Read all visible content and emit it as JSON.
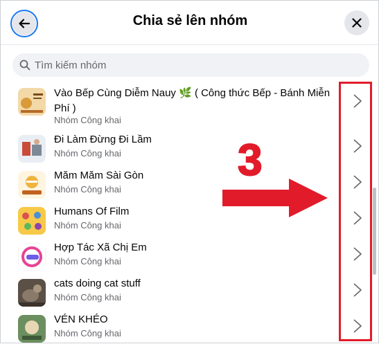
{
  "header": {
    "title": "Chia sẻ lên nhóm",
    "back_icon": "arrow-left-icon",
    "close_icon": "close-icon"
  },
  "search": {
    "placeholder": "Tìm kiếm nhóm",
    "value": ""
  },
  "groups": [
    {
      "name": "Vào Bếp Cùng Diễm Nauy 🌿 ( Công thức Bếp - Bánh Miễn Phí )",
      "privacy": "Nhóm Công khai"
    },
    {
      "name": "Đi Làm Đừng Đi Lầm",
      "privacy": "Nhóm Công khai"
    },
    {
      "name": "Măm Măm Sài Gòn",
      "privacy": "Nhóm Công khai"
    },
    {
      "name": "Humans Of Film",
      "privacy": "Nhóm Công khai"
    },
    {
      "name": "Hợp Tác Xã Chị Em",
      "privacy": "Nhóm Công khai"
    },
    {
      "name": "cats doing cat stuff",
      "privacy": "Nhóm Công khai"
    },
    {
      "name": "VÉN KHÉO",
      "privacy": "Nhóm Công khai"
    }
  ],
  "annotation": {
    "step_number": "3",
    "color": "#e21b2a"
  },
  "colors": {
    "accent": "#1877f2",
    "secondary_text": "#65676b"
  }
}
